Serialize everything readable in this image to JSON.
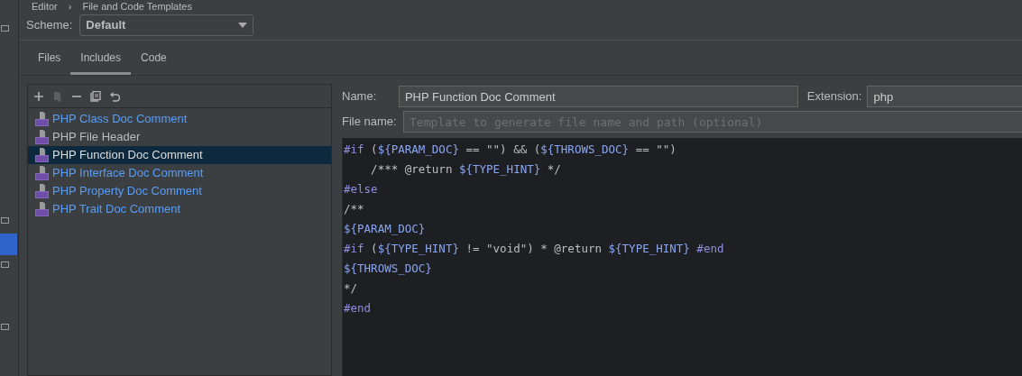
{
  "breadcrumb": [
    "Editor",
    "›",
    "File and Code Templates"
  ],
  "scheme": {
    "label": "Scheme:",
    "value": "Default"
  },
  "tabs": [
    {
      "label": "Files",
      "selected": false
    },
    {
      "label": "Includes",
      "selected": true
    },
    {
      "label": "Code",
      "selected": false
    }
  ],
  "toolbar": [
    {
      "kind": "add",
      "disabled": false
    },
    {
      "kind": "add-child",
      "disabled": true
    },
    {
      "kind": "remove",
      "disabled": false
    },
    {
      "kind": "copy",
      "disabled": false
    },
    {
      "kind": "reset",
      "disabled": false
    }
  ],
  "templates": [
    {
      "label": "PHP Class Doc Comment",
      "modified": true,
      "selected": false
    },
    {
      "label": "PHP File Header",
      "modified": false,
      "selected": false
    },
    {
      "label": "PHP Function Doc Comment",
      "modified": false,
      "selected": true
    },
    {
      "label": "PHP Interface Doc Comment",
      "modified": true,
      "selected": false
    },
    {
      "label": "PHP Property Doc Comment",
      "modified": true,
      "selected": false
    },
    {
      "label": "PHP Trait Doc Comment",
      "modified": true,
      "selected": false
    }
  ],
  "name": {
    "label": "Name:",
    "value": "PHP Function Doc Comment"
  },
  "extension": {
    "label": "Extension:",
    "value": "php"
  },
  "file_name": {
    "label": "File name:",
    "placeholder": "Template to generate file name and path (optional)"
  },
  "code_lines": [
    [
      {
        "kind": "directive",
        "text": "#if"
      },
      {
        "kind": "text",
        "text": " ("
      },
      {
        "kind": "variable",
        "text": "${PARAM_DOC}"
      },
      {
        "kind": "text",
        "text": " == \"\") && ("
      },
      {
        "kind": "variable",
        "text": "${THROWS_DOC}"
      },
      {
        "kind": "text",
        "text": " == \"\")"
      }
    ],
    [
      {
        "kind": "text",
        "text": "    /*** @return "
      },
      {
        "kind": "variable",
        "text": "${TYPE_HINT}"
      },
      {
        "kind": "text",
        "text": " */"
      }
    ],
    [
      {
        "kind": "directive",
        "text": "#else"
      }
    ],
    [
      {
        "kind": "text",
        "text": "/**"
      }
    ],
    [
      {
        "kind": "variable",
        "text": "${PARAM_DOC}"
      }
    ],
    [
      {
        "kind": "directive",
        "text": "#if"
      },
      {
        "kind": "text",
        "text": " ("
      },
      {
        "kind": "variable",
        "text": "${TYPE_HINT}"
      },
      {
        "kind": "text",
        "text": " != \"void\") * @return "
      },
      {
        "kind": "variable",
        "text": "${TYPE_HINT}"
      },
      {
        "kind": "directive",
        "text": " #end"
      }
    ],
    [
      {
        "kind": "variable",
        "text": "${THROWS_DOC}"
      }
    ],
    [
      {
        "kind": "text",
        "text": "*/"
      }
    ],
    [
      {
        "kind": "directive",
        "text": "#end"
      }
    ]
  ]
}
